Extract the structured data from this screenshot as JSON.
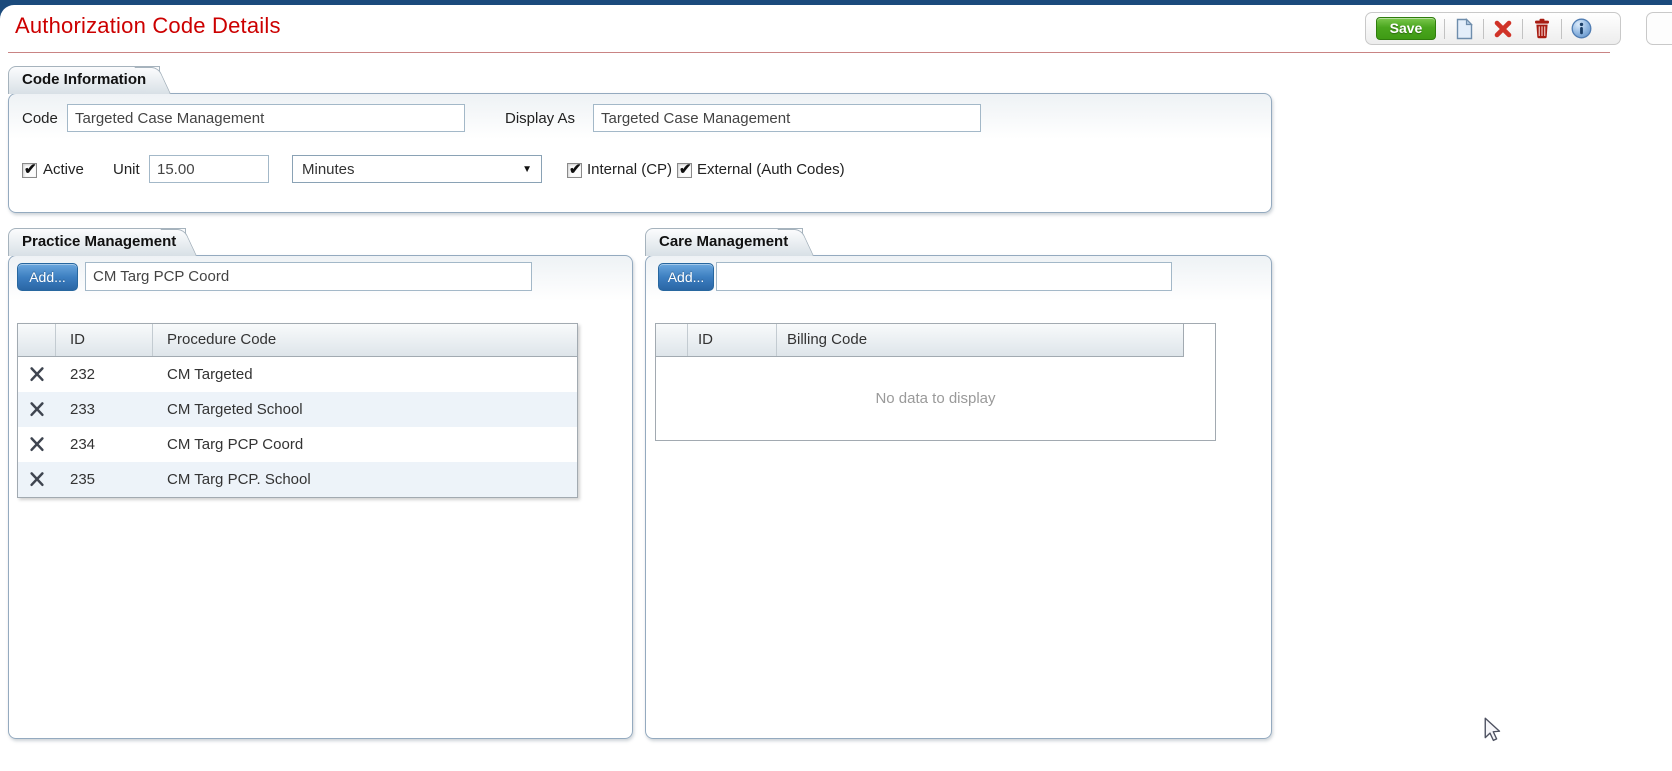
{
  "header": {
    "title": "Authorization Code Details",
    "toolbar": {
      "save_label": "Save",
      "icons": [
        "new-document",
        "delete",
        "trash",
        "info"
      ]
    }
  },
  "code_information": {
    "tab_label": "Code Information",
    "code_label": "Code",
    "code_value": "Targeted Case Management",
    "display_as_label": "Display As",
    "display_as_value": "Targeted Case Management",
    "active_label": "Active",
    "active_checked": true,
    "unit_label": "Unit",
    "unit_value": "15.00",
    "unit_type_selected": "Minutes",
    "internal_label": "Internal (CP)",
    "internal_checked": true,
    "external_label": "External (Auth Codes)",
    "external_checked": true
  },
  "practice_management": {
    "tab_label": "Practice Management",
    "add_label": "Add...",
    "filter_value": "CM Targ PCP Coord",
    "table": {
      "columns": [
        "",
        "ID",
        "Procedure Code"
      ],
      "rows": [
        {
          "id": "232",
          "code": "CM Targeted"
        },
        {
          "id": "233",
          "code": "CM Targeted School"
        },
        {
          "id": "234",
          "code": "CM Targ PCP Coord"
        },
        {
          "id": "235",
          "code": "CM Targ PCP. School"
        }
      ]
    }
  },
  "care_management": {
    "tab_label": "Care Management",
    "add_label": "Add...",
    "filter_value": "",
    "table": {
      "columns": [
        "",
        "ID",
        "Billing Code"
      ],
      "rows": [],
      "empty_message": "No data to display"
    }
  },
  "colors": {
    "title_red": "#cc0000",
    "topbar_blue": "#1b4a7c",
    "save_green": "#4aa61e",
    "add_blue": "#3d7fc1",
    "panel_border": "#94aabf",
    "row_alt": "#edf3f9"
  }
}
